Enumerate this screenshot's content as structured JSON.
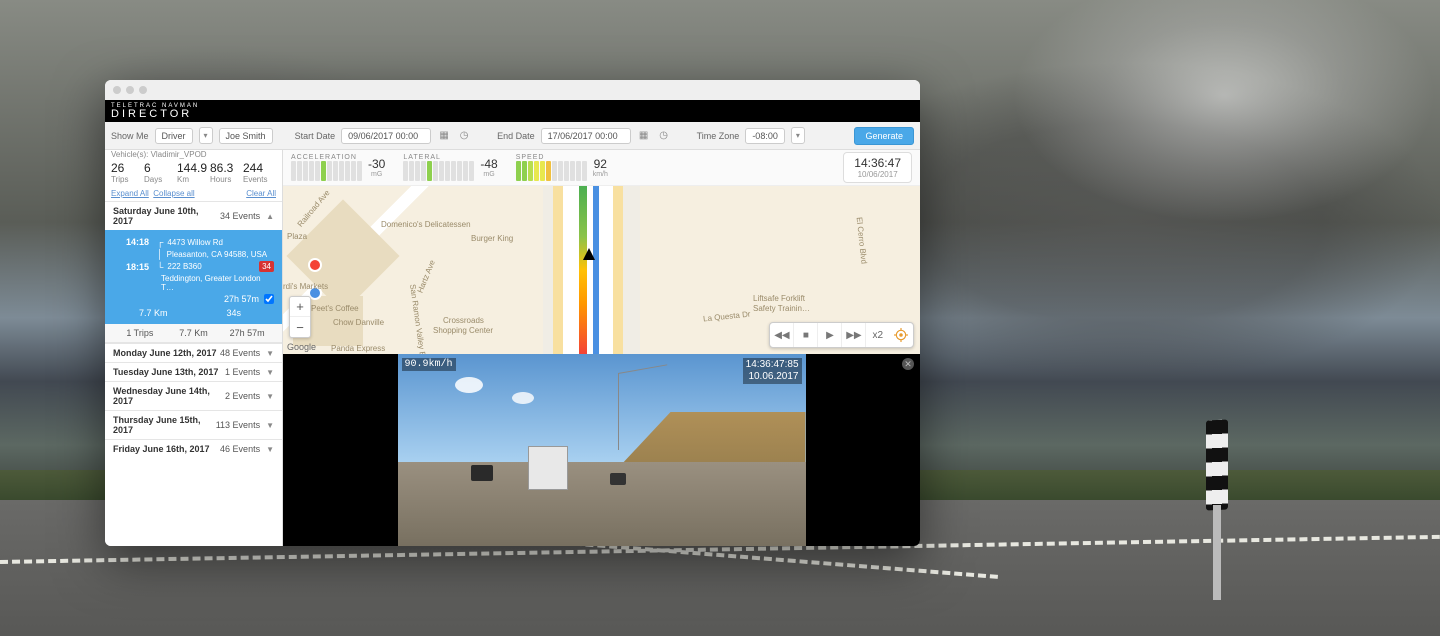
{
  "brand": {
    "top": "TELETRAC NAVMAN",
    "bottom": "DIRECTOR"
  },
  "filter": {
    "showMe": "Show Me",
    "driverLabel": "Driver",
    "driverName": "Joe Smith",
    "startDateLabel": "Start Date",
    "startDate": "09/06/2017 00:00",
    "endDateLabel": "End Date",
    "endDate": "17/06/2017 00:00",
    "timeZoneLabel": "Time Zone",
    "timeZone": "-08:00",
    "generate": "Generate"
  },
  "summary": {
    "vehicleLine": "Vehicle(s): Vladimir_VPOD",
    "trips": {
      "v": "26",
      "l": "Trips"
    },
    "days": {
      "v": "6",
      "l": "Days"
    },
    "km": {
      "v": "144.9",
      "l": "Km"
    },
    "hours": {
      "v": "86.3",
      "l": "Hours"
    },
    "events": {
      "v": "244",
      "l": "Events"
    },
    "expand": "Expand All",
    "collapse": "Collapse all",
    "clear": "Clear All"
  },
  "trips": {
    "expanded": {
      "date": "Saturday June 10th, 2017",
      "count": "34 Events",
      "r1time": "14:18",
      "r1addr": "4473 Willow Rd",
      "r2addr": "Pleasanton, CA 94588, USA",
      "r3time": "18:15",
      "r3addr": "222 B360",
      "r4addr": "Teddington, Greater London T…",
      "badge": "34",
      "dur": "27h 57m",
      "km": "7.7 Km",
      "idle": "34s"
    },
    "subfoot": {
      "trips": "1 Trips",
      "km": "7.7 Km",
      "dur": "27h 57m"
    },
    "rows": [
      {
        "date": "Monday June 12th, 2017",
        "count": "48 Events"
      },
      {
        "date": "Tuesday June 13th, 2017",
        "count": "1 Events"
      },
      {
        "date": "Wednesday June 14th, 2017",
        "count": "2 Events"
      },
      {
        "date": "Thursday June 15th, 2017",
        "count": "113 Events"
      },
      {
        "date": "Friday June 16th, 2017",
        "count": "46 Events"
      }
    ]
  },
  "gauges": {
    "accel": {
      "label": "ACCELERATION",
      "val": "-30",
      "unit": "mG"
    },
    "lateral": {
      "label": "LATERAL",
      "val": "-48",
      "unit": "mG"
    },
    "speed": {
      "label": "SPEED",
      "val": "92",
      "unit": "km/h"
    }
  },
  "clock": {
    "time": "14:36:47",
    "date": "10/06/2017"
  },
  "map": {
    "labels": {
      "plaza": "Plaza",
      "markets": "rdi's Markets",
      "peets": "Peet's Coffee",
      "chow": "Chow Danville",
      "panda": "Panda Express",
      "delicatessen": "Domenico's Delicatessen",
      "bk": "Burger King",
      "crossroads": "Crossroads",
      "crossroads2": "Shopping Center",
      "liftsafe": "Liftsafe Forklift",
      "liftsafe2": "Safety Trainin…",
      "railroad": "Railroad Ave",
      "hartz": "Hartz Ave",
      "sanramon": "San Ramon Valley B",
      "laquesta": "La Questa Dr",
      "elcerro": "El Cerro Blvd"
    },
    "google": "Google",
    "playSpeed": "x2"
  },
  "video": {
    "speed": "90.9km/h",
    "timestamp": "14:36:47:85",
    "date": "10.06.2017"
  }
}
